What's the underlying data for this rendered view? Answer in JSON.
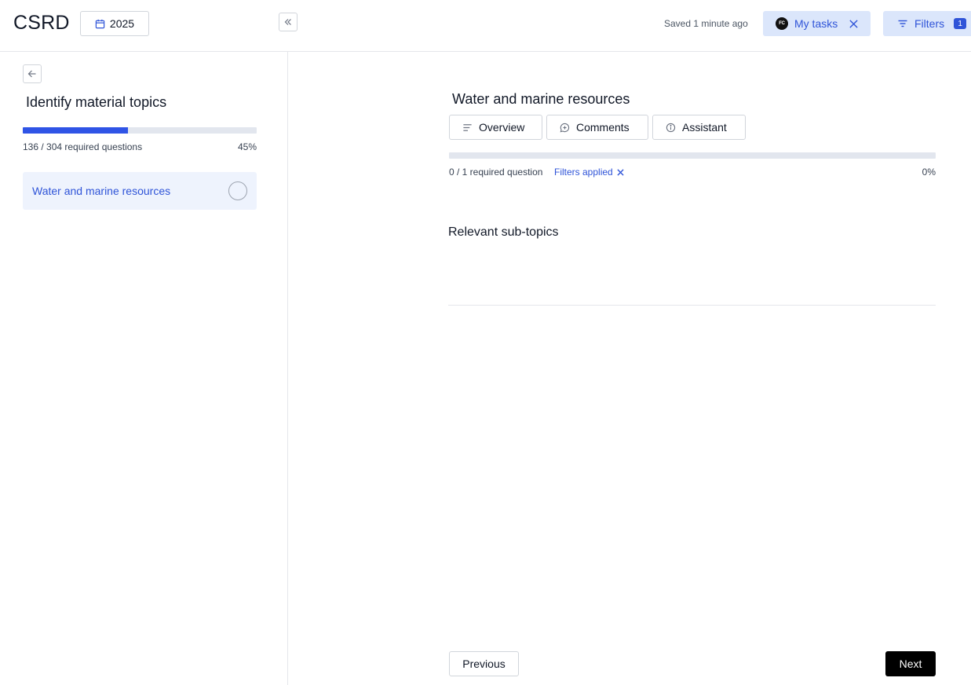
{
  "header": {
    "app_title": "CSRD",
    "year": "2025",
    "saved_status": "Saved 1 minute ago",
    "my_tasks": {
      "avatar_initials": "FC",
      "label": "My tasks"
    },
    "filters": {
      "label": "Filters",
      "count": "1"
    }
  },
  "sidebar": {
    "title": "Identify material topics",
    "progress": {
      "text": "136 / 304 required questions",
      "percent_label": "45%",
      "fraction": 0.45
    },
    "items": [
      {
        "label": "Water and marine resources",
        "selected": true
      }
    ]
  },
  "main": {
    "title": "Water and marine resources",
    "tabs": [
      {
        "label": "Overview",
        "icon": "lines-icon"
      },
      {
        "label": "Comments",
        "icon": "comment-plus-icon"
      },
      {
        "label": "Assistant",
        "icon": "info-icon"
      }
    ],
    "progress": {
      "text": "0 / 1 required question",
      "filters_applied": "Filters applied",
      "percent_label": "0%",
      "fraction": 0
    },
    "section_title": "Relevant sub-topics",
    "previous_label": "Previous",
    "next_label": "Next"
  },
  "colors": {
    "accent": "#2f54d8",
    "accent_bg": "#dbe6fb",
    "selected_bg": "#eef3fd"
  }
}
